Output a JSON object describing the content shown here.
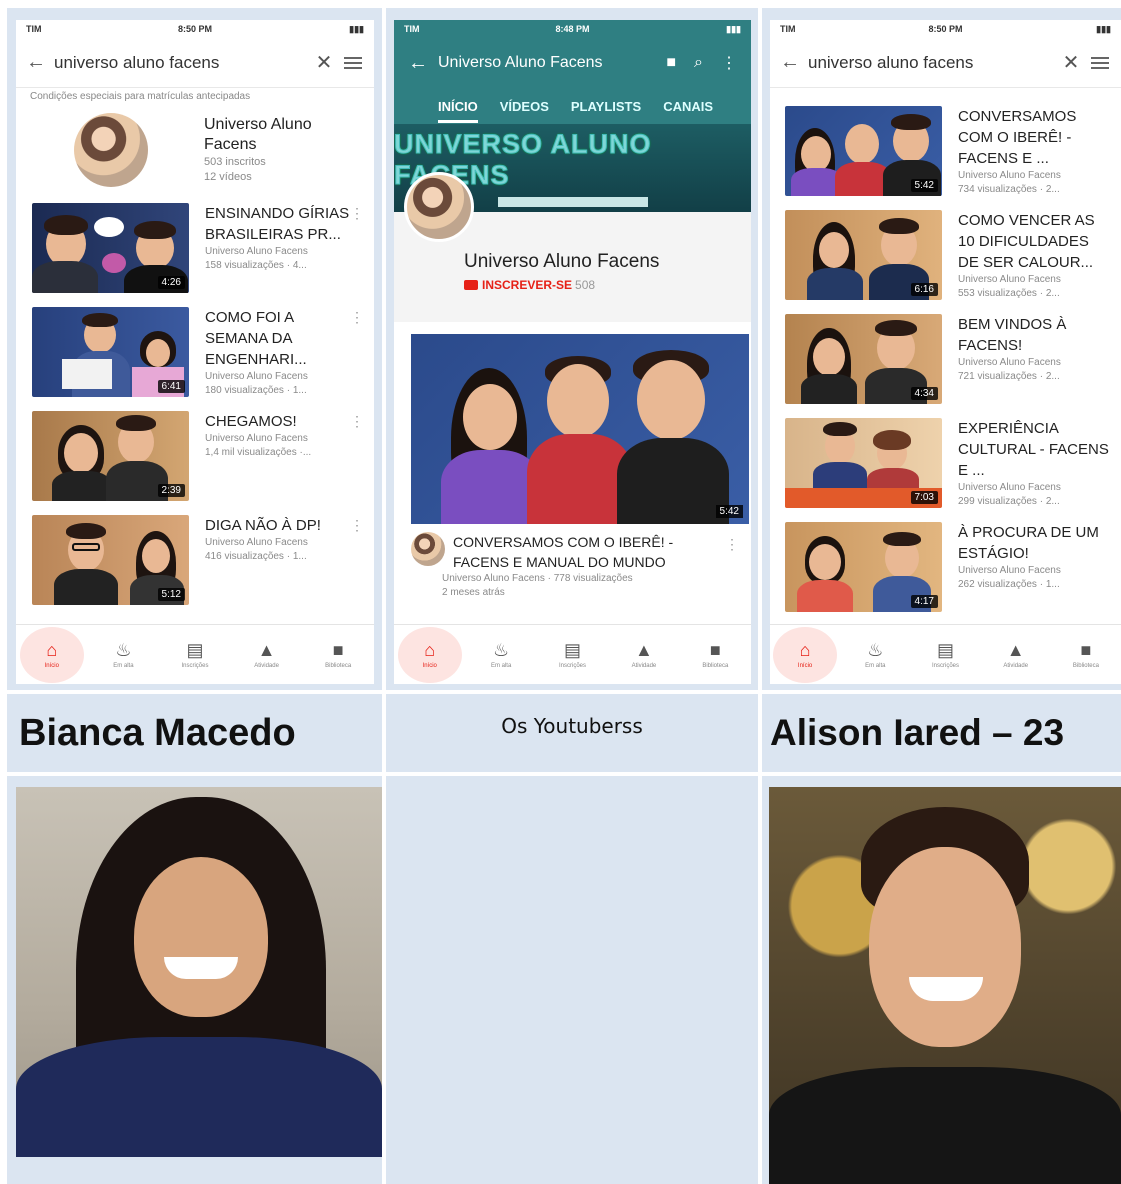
{
  "status": {
    "carrier": "TIM",
    "time_left": "8:50 PM",
    "time_mid": "8:48 PM",
    "time_right": "8:50 PM"
  },
  "search": {
    "query": "universo aluno facens"
  },
  "left_screen": {
    "promo": "Condições especiais para matrículas antecipadas",
    "channel": {
      "name": "Universo Aluno Facens",
      "subscribers": "503 inscritos",
      "videos": "12 vídeos"
    },
    "videos": [
      {
        "title": "ENSINANDO GÍRIAS BRASILEIRAS PR...",
        "channel": "Universo Aluno Facens",
        "meta": "158 visualizações · 4...",
        "duration": "4:26"
      },
      {
        "title": "COMO FOI A SEMANA DA ENGENHARI...",
        "channel": "Universo Aluno Facens",
        "meta": "180 visualizações · 1...",
        "duration": "6:41"
      },
      {
        "title": "CHEGAMOS!",
        "channel": "Universo Aluno Facens",
        "meta": "1,4 mil visualizações ·...",
        "duration": "2:39"
      },
      {
        "title": "DIGA NÃO À DP!",
        "channel": "Universo Aluno Facens",
        "meta": "416 visualizações · 1...",
        "duration": "5:12"
      }
    ]
  },
  "middle_screen": {
    "title": "Universo Aluno Facens",
    "tabs": [
      "INÍCIO",
      "VÍDEOS",
      "PLAYLISTS",
      "CANAIS"
    ],
    "banner_text": "UNIVERSO ALUNO FACENS",
    "channel_name": "Universo Aluno Facens",
    "subscribe_label": "INSCREVER-SE",
    "subscribe_count": "508",
    "featured": {
      "title": "CONVERSAMOS COM O IBERÊ! - FACENS E MANUAL DO MUNDO",
      "meta1": "Universo Aluno Facens · 778 visualizações",
      "meta2": "2 meses atrás",
      "duration": "5:42"
    }
  },
  "right_screen": {
    "videos": [
      {
        "title": "CONVERSAMOS COM O IBERÊ! - FACENS E ...",
        "channel": "Universo Aluno Facens",
        "meta": "734 visualizações · 2...",
        "duration": "5:42"
      },
      {
        "title": "COMO VENCER AS 10 DIFICULDADES DE SER CALOUR...",
        "channel": "Universo Aluno Facens",
        "meta": "553 visualizações · 2...",
        "duration": "6:16"
      },
      {
        "title": "BEM VINDOS À FACENS!",
        "channel": "Universo Aluno Facens",
        "meta": "721 visualizações · 2...",
        "duration": "4:34"
      },
      {
        "title": "EXPERIÊNCIA CULTURAL - FACENS E ...",
        "channel": "Universo Aluno Facens",
        "meta": "299 visualizações · 2...",
        "duration": "7:03"
      },
      {
        "title": "À PROCURA DE UM ESTÁGIO!",
        "channel": "Universo Aluno Facens",
        "meta": "262 visualizações · 1...",
        "duration": "4:17"
      }
    ]
  },
  "bottom_nav": [
    "Início",
    "Em alta",
    "Inscrições",
    "Atividade",
    "Biblioteca"
  ],
  "labels": {
    "left_name": "Bianca Macedo",
    "middle": "Os Youtuberss",
    "right_name": "Alison Iared – 23"
  },
  "colors": {
    "cell_bg": "#dbe5f1",
    "youtube_red": "#e62117",
    "channel_teal": "#2f7f82"
  }
}
